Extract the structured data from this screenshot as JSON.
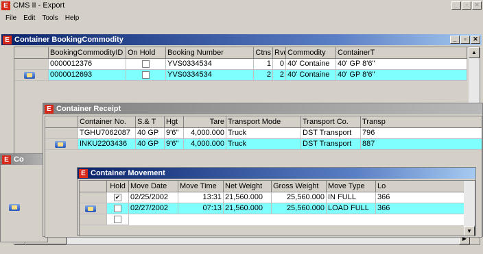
{
  "app": {
    "title": "CMS II - Export",
    "menu": [
      "File",
      "Edit",
      "Tools",
      "Help"
    ]
  },
  "wBC": {
    "title": "Container BookingCommodity",
    "columns": [
      "BookingCommodityID",
      "On Hold",
      "Booking Number",
      "Ctns",
      "Rvd",
      "Commodity",
      "ContainerT"
    ],
    "rows": [
      [
        "0000012376",
        "",
        "YVS0334534",
        "1",
        "0",
        "40' Containe",
        "40' GP 8'6\""
      ],
      [
        "0000012693",
        "",
        "YVS0334534",
        "2",
        "2",
        "40' Containe",
        "40' GP 8'6\""
      ]
    ]
  },
  "wBehind": {
    "title": "Co"
  },
  "wCR": {
    "title": "Container Receipt",
    "columns": [
      "Container No.",
      "S.& T",
      "Hgt",
      "Tare",
      "Transport Mode",
      "Transport Co.",
      "Transp"
    ],
    "rows": [
      [
        "TGHU7062087",
        "40 GP",
        "9'6\"",
        "4,000.000",
        "Truck",
        "DST Transport",
        "796"
      ],
      [
        "INKU2203436",
        "40 GP",
        "9'6\"",
        "4,000.000",
        "Truck",
        "DST Transport",
        "887"
      ]
    ]
  },
  "wCM": {
    "title": "Container Movement",
    "columns": [
      "Hold",
      "Move Date",
      "Move Time",
      "Net Weight",
      "Gross Weight",
      "Move Type",
      "Lo"
    ],
    "rows": [
      [
        "✔",
        "02/25/2002",
        "13:31",
        "21,560.000",
        "25,560.000",
        "IN FULL",
        "366"
      ],
      [
        "",
        "02/27/2002",
        "07:13",
        "21,560.000",
        "25,560.000",
        "LOAD FULL",
        "366"
      ]
    ]
  },
  "icons": {
    "app": "E"
  }
}
